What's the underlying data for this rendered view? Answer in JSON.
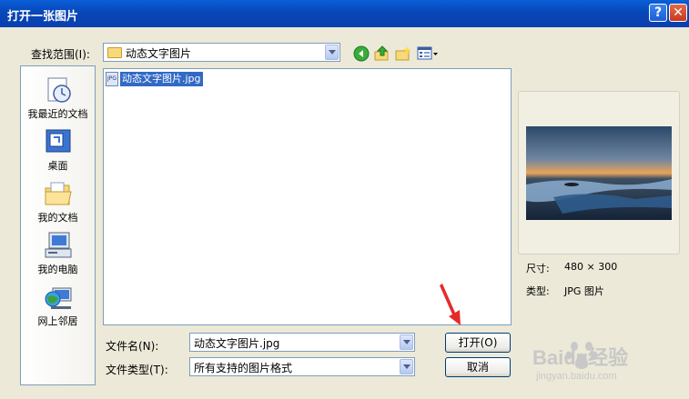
{
  "window": {
    "title": "打开一张图片",
    "help_glyph": "?",
    "close_glyph": "✕"
  },
  "lookin": {
    "label": "查找范围(I):",
    "value": "动态文字图片"
  },
  "toolbar_icons": [
    "back-arrow-icon",
    "up-folder-icon",
    "new-folder-icon",
    "view-menu-icon"
  ],
  "places": [
    {
      "label": "我最近的文档",
      "icon": "recent-documents-icon"
    },
    {
      "label": "桌面",
      "icon": "desktop-icon"
    },
    {
      "label": "我的文档",
      "icon": "my-documents-icon"
    },
    {
      "label": "我的电脑",
      "icon": "my-computer-icon"
    },
    {
      "label": "网上邻居",
      "icon": "network-places-icon"
    }
  ],
  "files": [
    {
      "name": "动态文字图片.jpg",
      "icon_text": "JPG",
      "selected": true
    }
  ],
  "preview": {
    "size_label": "尺寸:",
    "size_value": "480 × 300",
    "type_label": "类型:",
    "type_value": "JPG 图片"
  },
  "filename": {
    "label": "文件名(N):",
    "value": "动态文字图片.jpg"
  },
  "filetype": {
    "label": "文件类型(T):",
    "value": "所有支持的图片格式"
  },
  "buttons": {
    "open": "打开(O)",
    "cancel": "取消"
  },
  "watermark": {
    "brand": "Baidu经验",
    "url": "jingyan.baidu.com"
  },
  "colors": {
    "title_bar": "#0a4fc4",
    "selection": "#316ac5",
    "dialog_bg": "#ece9d8",
    "arrow": "#e52a2a"
  }
}
